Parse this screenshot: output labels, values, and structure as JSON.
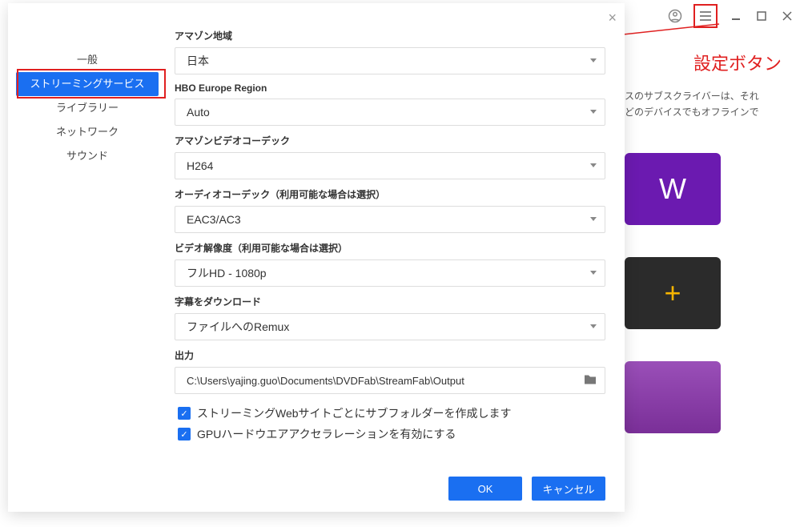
{
  "annotation": {
    "settings_button_label": "設定ボタン"
  },
  "titlebar": {
    "account_icon": "account-circle",
    "hamburger_icon": "menu",
    "minimize_icon": "minimize",
    "maximize_icon": "maximize",
    "close_icon": "close"
  },
  "background": {
    "description_line1": "スのサブスクライバーは、それ",
    "description_line2": "どのデバイスでもオフラインで",
    "tiles": [
      {
        "glyph": "W"
      },
      {
        "glyph": "+"
      },
      {
        "glyph": ""
      }
    ]
  },
  "dialog": {
    "close_glyph": "×",
    "sidebar": {
      "items": [
        {
          "label": "一般",
          "active": false
        },
        {
          "label": "ストリーミングサービス",
          "active": true
        },
        {
          "label": "ライブラリー",
          "active": false
        },
        {
          "label": "ネットワーク",
          "active": false
        },
        {
          "label": "サウンド",
          "active": false
        }
      ]
    },
    "fields": {
      "amazon_region": {
        "label": "アマゾン地域",
        "value": "日本"
      },
      "hbo_region": {
        "label": "HBO Europe Region",
        "value": "Auto"
      },
      "video_codec": {
        "label": "アマゾンビデオコーデック",
        "value": "H264"
      },
      "audio_codec": {
        "label": "オーディオコーデック（利用可能な場合は選択）",
        "value": "EAC3/AC3"
      },
      "resolution": {
        "label": "ビデオ解像度（利用可能な場合は選択）",
        "value": "フルHD - 1080p"
      },
      "subtitles": {
        "label": "字幕をダウンロード",
        "value": "ファイルへのRemux"
      },
      "output": {
        "label": "出力",
        "value": "C:\\Users\\yajing.guo\\Documents\\DVDFab\\StreamFab\\Output"
      }
    },
    "checkboxes": {
      "subfolder": {
        "label": "ストリーミングWebサイトごとにサブフォルダーを作成します",
        "checked": true
      },
      "gpu": {
        "label": "GPUハードウエアアクセラレーションを有効にする",
        "checked": true
      }
    },
    "buttons": {
      "ok": "OK",
      "cancel": "キャンセル"
    }
  }
}
